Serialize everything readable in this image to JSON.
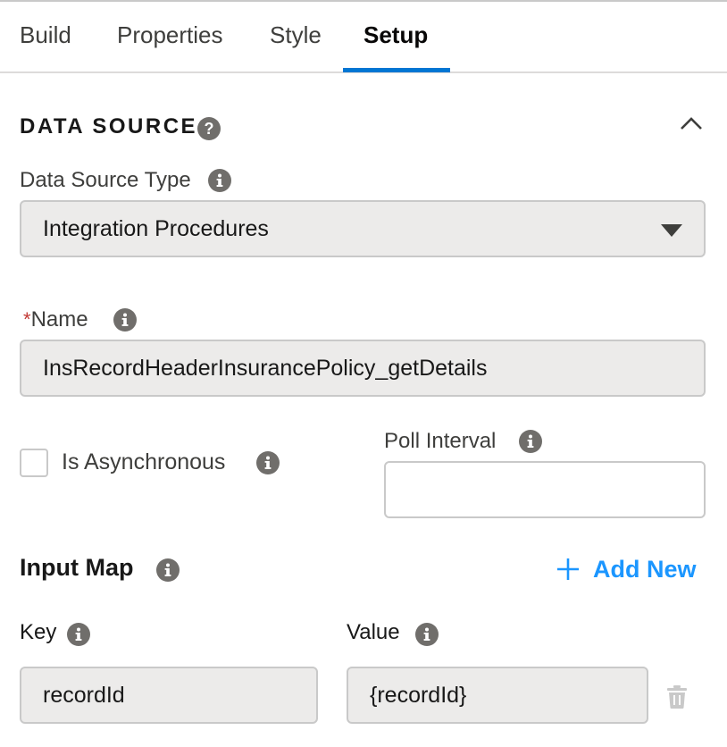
{
  "tabs": [
    {
      "label": "Build"
    },
    {
      "label": "Properties"
    },
    {
      "label": "Style"
    },
    {
      "label": "Setup",
      "active": true
    }
  ],
  "data_source": {
    "section_title": "DATA SOURCE",
    "type_label": "Data Source Type",
    "type_value": "Integration Procedures",
    "name_required_mark": "*",
    "name_label": "Name",
    "name_value": "InsRecordHeaderInsurancePolicy_getDetails",
    "async_label": "Is Asynchronous",
    "async_checked": false,
    "poll_label": "Poll Interval",
    "poll_value": ""
  },
  "input_map": {
    "title": "Input Map",
    "add_new_label": "Add New",
    "key_label": "Key",
    "value_label": "Value",
    "rows": [
      {
        "key": "recordId",
        "value": "{recordId}"
      }
    ]
  },
  "colors": {
    "accent": "#0176d3",
    "link": "#1b96ff",
    "required": "#c23934",
    "icon": "#706e6b"
  },
  "icons": [
    "help-icon",
    "info-icon",
    "chevron-up-icon",
    "chevron-down-icon",
    "plus-icon",
    "trash-icon"
  ]
}
